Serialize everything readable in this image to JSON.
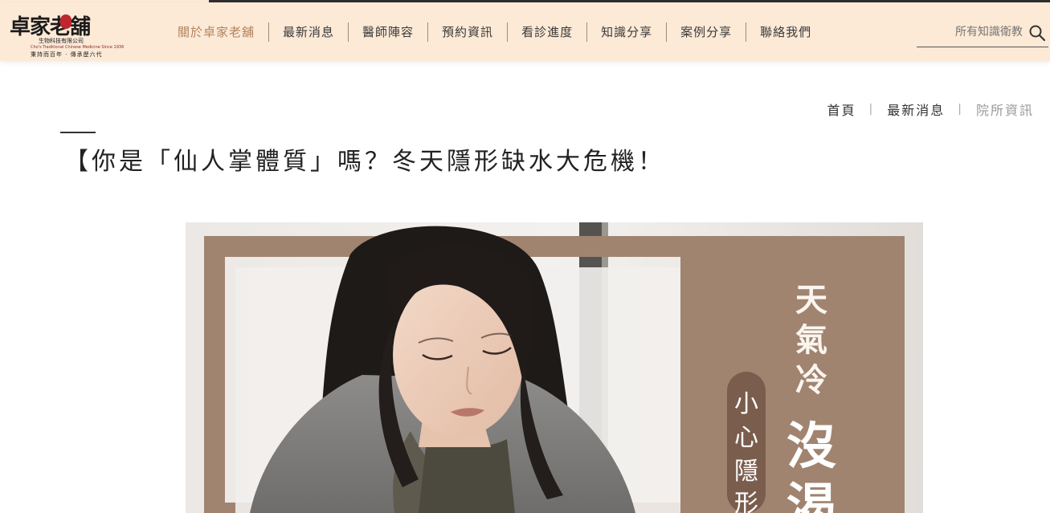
{
  "brand": {
    "logo_main": "卓家老舖",
    "logo_sub": "生物科技有限公司",
    "logo_en": "Cho's Traditional Chinese Medicine Since 1936",
    "logo_slogan": "秉持而百年 · 傳承歷六代",
    "colors": {
      "header_bg": "#fce9d6",
      "accent": "#b0845e",
      "hero_brown": "#a08470"
    }
  },
  "nav": {
    "items": [
      {
        "label": "關於卓家老舖",
        "active": true
      },
      {
        "label": "最新消息"
      },
      {
        "label": "醫師陣容"
      },
      {
        "label": "預約資訊"
      },
      {
        "label": "看診進度"
      },
      {
        "label": "知識分享"
      },
      {
        "label": "案例分享"
      },
      {
        "label": "聯絡我們"
      }
    ]
  },
  "search": {
    "placeholder": "所有知識衛教",
    "icon": "search-icon"
  },
  "breadcrumb": {
    "items": [
      "首頁",
      "最新消息",
      "院所資訊"
    ]
  },
  "article": {
    "title": "【你是「仙人掌體質」嗎？冬天隱形缺水大危機！"
  },
  "hero": {
    "headline": "天氣冷",
    "headline_big": "沒渴",
    "pill_text": "小心隱形"
  }
}
